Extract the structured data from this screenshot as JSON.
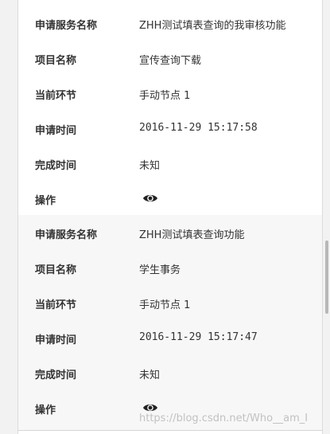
{
  "records": [
    {
      "fields": [
        {
          "label": "申请服务名称",
          "value": "ZHH测试填表查询的我审核功能"
        },
        {
          "label": "项目名称",
          "value": "宣传查询下载"
        },
        {
          "label": "当前环节",
          "value": "手动节点 1"
        },
        {
          "label": "申请时间",
          "value": "2016-11-29 15:17:58"
        },
        {
          "label": "完成时间",
          "value": "未知"
        },
        {
          "label": "操作",
          "icon": "eye-icon"
        }
      ]
    },
    {
      "fields": [
        {
          "label": "申请服务名称",
          "value": "ZHH测试填表查询功能"
        },
        {
          "label": "项目名称",
          "value": "学生事务"
        },
        {
          "label": "当前环节",
          "value": "手动节点 1"
        },
        {
          "label": "申请时间",
          "value": "2016-11-29 15:17:47"
        },
        {
          "label": "完成时间",
          "value": "未知"
        },
        {
          "label": "操作",
          "icon": "eye-icon"
        }
      ]
    }
  ],
  "watermark": "https://blog.csdn.net/Who__am_I",
  "colors": {
    "panel_bg": "#ffffff",
    "alt_row_bg": "#f7f7f7",
    "page_bg": "#f2f2f2",
    "text": "#333333"
  }
}
